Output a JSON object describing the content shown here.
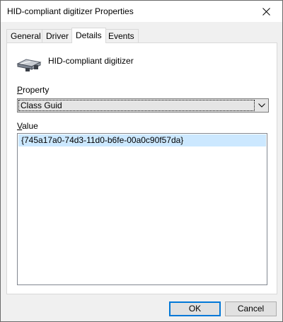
{
  "window": {
    "title": "HID-compliant digitizer Properties"
  },
  "tabs": [
    {
      "label": "General",
      "active": false
    },
    {
      "label": "Driver",
      "active": false
    },
    {
      "label": "Details",
      "active": true
    },
    {
      "label": "Events",
      "active": false
    }
  ],
  "device": {
    "name": "HID-compliant digitizer",
    "icon": "device-icon"
  },
  "property": {
    "label": "Property",
    "selected": "Class Guid"
  },
  "value": {
    "label": "Value",
    "items": [
      "{745a17a0-74d3-11d0-b6fe-00a0c90f57da}"
    ]
  },
  "buttons": {
    "ok": "OK",
    "cancel": "Cancel"
  },
  "colors": {
    "selection": "#cce8ff",
    "accent": "#0078d7"
  }
}
